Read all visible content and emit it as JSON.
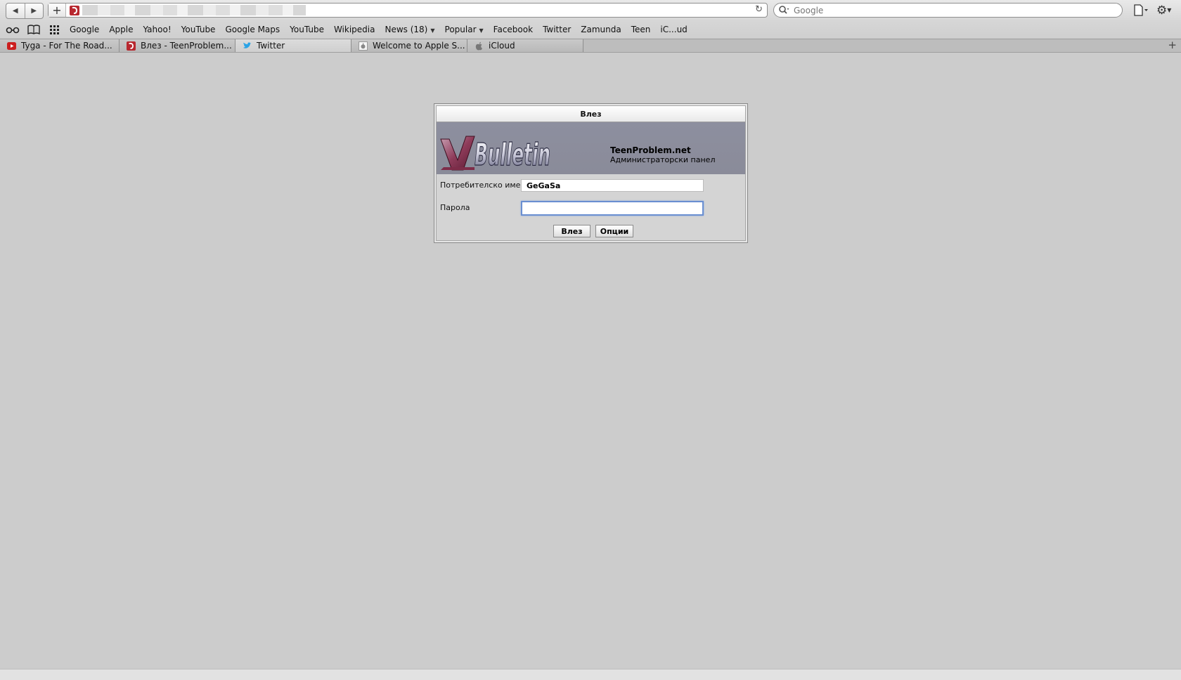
{
  "toolbar": {
    "back_label": "◀",
    "forward_label": "▶",
    "add_label": "+",
    "reload_label": "↻",
    "search_placeholder": "Google",
    "gear_label": "⚙"
  },
  "bookmarks": {
    "items": [
      {
        "label": "Google"
      },
      {
        "label": "Apple"
      },
      {
        "label": "Yahoo!"
      },
      {
        "label": "YouTube"
      },
      {
        "label": "Google Maps"
      },
      {
        "label": "YouTube"
      },
      {
        "label": "Wikipedia"
      },
      {
        "label": "News (18)",
        "has_menu": true
      },
      {
        "label": "Popular",
        "has_menu": true
      },
      {
        "label": "Facebook"
      },
      {
        "label": "Twitter"
      },
      {
        "label": "Zamunda"
      },
      {
        "label": "Teen"
      },
      {
        "label": "iC...ud"
      }
    ],
    "caret": "▼"
  },
  "tabs": [
    {
      "label": "Tyga - For The Road...",
      "icon": "youtube-icon"
    },
    {
      "label": "Влез - TeenProblem...",
      "icon": "vbulletin-icon"
    },
    {
      "label": "Twitter",
      "icon": "twitter-icon",
      "active": true
    },
    {
      "label": "Welcome to Apple S...",
      "icon": "apple-page-icon"
    },
    {
      "label": "iCloud",
      "icon": "apple-icon"
    }
  ],
  "new_tab_label": "+",
  "colors": {
    "page_background": "#cccccc",
    "banner": "#8d8f9f",
    "focus_ring": "#6a8fd1"
  },
  "login": {
    "title": "Влез",
    "site_name": "TeenProblem.net",
    "panel_name": "Администраторски панел",
    "username_label": "Потребителско име",
    "username_value": "GeGaSa",
    "password_label": "Парола",
    "password_value": "",
    "login_button": "Влез",
    "options_button": "Опции"
  }
}
